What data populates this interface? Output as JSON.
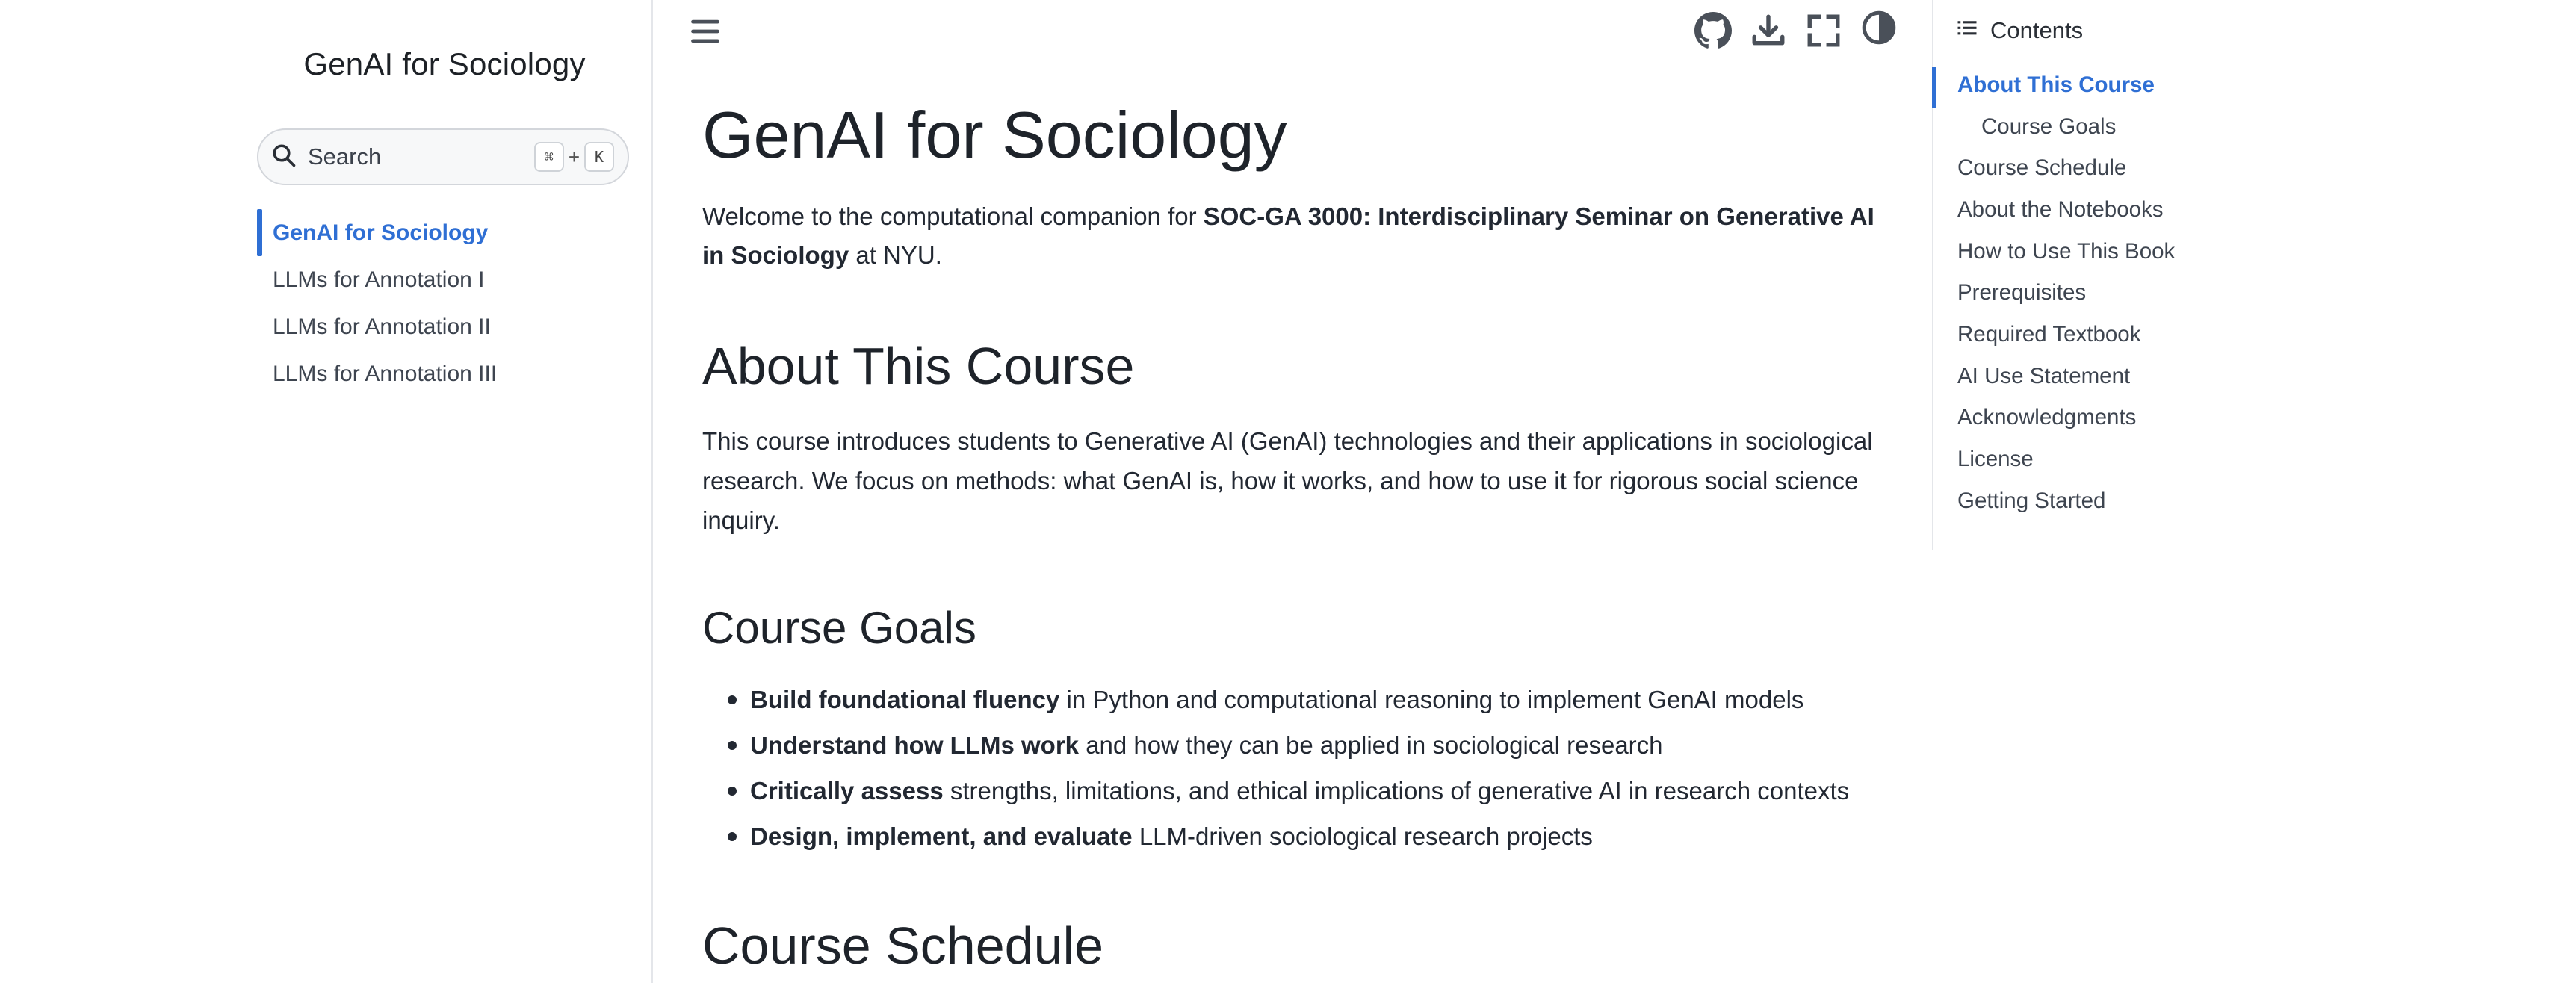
{
  "sidebar": {
    "brand": "GenAI for Sociology",
    "search": {
      "placeholder": "Search",
      "shortcut_key1": "⌘",
      "shortcut_plus": "+",
      "shortcut_key2": "K"
    },
    "nav": [
      {
        "label": "GenAI for Sociology",
        "active": true
      },
      {
        "label": "LLMs for Annotation I",
        "active": false
      },
      {
        "label": "LLMs for Annotation II",
        "active": false
      },
      {
        "label": "LLMs for Annotation III",
        "active": false
      }
    ]
  },
  "toolbar": {
    "icons": [
      "menu-icon",
      "github-icon",
      "download-icon",
      "fullscreen-icon",
      "theme-toggle-icon"
    ]
  },
  "main": {
    "title": "GenAI for Sociology",
    "intro": {
      "before": "Welcome to the computational companion for ",
      "bold": "SOC-GA 3000: Interdisciplinary Seminar on Generative AI in Sociology",
      "after": " at NYU."
    },
    "about_heading": "About This Course",
    "about_text": "This course introduces students to Generative AI (GenAI) technologies and their applications in sociological research. We focus on methods: what GenAI is, how it works, and how to use it for rigorous social science inquiry.",
    "goals_heading": "Course Goals",
    "goals": [
      {
        "bold": "Build foundational fluency",
        "rest": " in Python and computational reasoning to implement GenAI models"
      },
      {
        "bold": "Understand how LLMs work",
        "rest": " and how they can be applied in sociological research"
      },
      {
        "bold": "Critically assess",
        "rest": " strengths, limitations, and ethical implications of generative AI in research contexts"
      },
      {
        "bold": "Design, implement, and evaluate",
        "rest": " LLM-driven sociological research projects"
      }
    ],
    "schedule_heading": "Course Schedule"
  },
  "toc": {
    "heading": "Contents",
    "items": [
      {
        "label": "About This Course",
        "active": true,
        "sub": false
      },
      {
        "label": "Course Goals",
        "active": false,
        "sub": true
      },
      {
        "label": "Course Schedule",
        "active": false,
        "sub": false
      },
      {
        "label": "About the Notebooks",
        "active": false,
        "sub": false
      },
      {
        "label": "How to Use This Book",
        "active": false,
        "sub": false
      },
      {
        "label": "Prerequisites",
        "active": false,
        "sub": false
      },
      {
        "label": "Required Textbook",
        "active": false,
        "sub": false
      },
      {
        "label": "AI Use Statement",
        "active": false,
        "sub": false
      },
      {
        "label": "Acknowledgments",
        "active": false,
        "sub": false
      },
      {
        "label": "License",
        "active": false,
        "sub": false
      },
      {
        "label": "Getting Started",
        "active": false,
        "sub": false
      }
    ]
  },
  "colors": {
    "accent": "#2f6fd4",
    "text": "#222832",
    "border": "#e4e6ea"
  }
}
